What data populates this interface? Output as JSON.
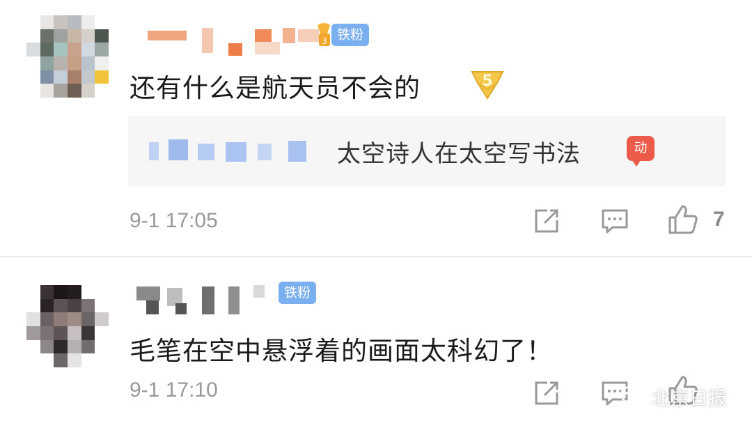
{
  "colors": {
    "fan_badge": "#7ab0f0",
    "comment_text": "#1a1a1a",
    "timestamp": "#999999",
    "quote_background": "#f6f6f6",
    "hot_badge": "#ec5a4a"
  },
  "comments": [
    {
      "badge": "铁粉",
      "text": "还有什么是航天员不会的",
      "emoji_icon": "level-5-badge-emoji",
      "quote": {
        "text": "太空诗人在太空写书法",
        "badge": "动"
      },
      "time": "9-1 17:05",
      "like_count": "7",
      "icons": [
        "share-icon",
        "reply-icon",
        "like-icon"
      ]
    },
    {
      "badge": "铁粉",
      "text": "毛笔在空中悬浮着的画面太科幻了！",
      "time": "9-1 17:10",
      "like_count": "",
      "icons": [
        "share-icon",
        "reply-icon",
        "like-icon"
      ]
    }
  ],
  "watermark": {
    "text": "北京日报",
    "icon": "wechat-icon"
  }
}
